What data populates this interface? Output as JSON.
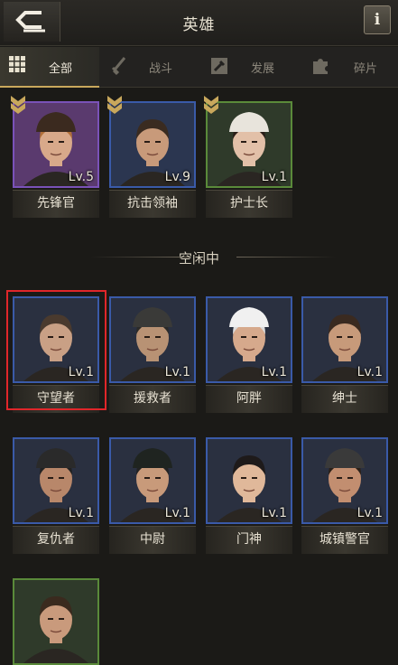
{
  "header": {
    "title": "英雄",
    "info_label": "i"
  },
  "tabs": [
    {
      "label": "全部",
      "icon": "grid-icon"
    },
    {
      "label": "战斗",
      "icon": "sword-icon"
    },
    {
      "label": "发展",
      "icon": "hammer-icon"
    },
    {
      "label": "碎片",
      "icon": "puzzle-icon"
    }
  ],
  "deployed": [
    {
      "name": "先锋官",
      "level": "Lv.5",
      "frame": "purple",
      "bg": "#5a3a6e",
      "hair": "#b0703a",
      "skin": "#d8a98a",
      "hat": "#3b2a1f"
    },
    {
      "name": "抗击领袖",
      "level": "Lv.9",
      "frame": "blue",
      "bg": "#2b3650",
      "hair": "#3a2b20",
      "skin": "#c89a7a",
      "hat": ""
    },
    {
      "name": "护士长",
      "level": "Lv.1",
      "frame": "green",
      "bg": "#2f3a2a",
      "hair": "#2a1e18",
      "skin": "#e2c0a8",
      "hat": "#e8e4dc"
    }
  ],
  "section_label": "空闲中",
  "idle": [
    {
      "name": "守望者",
      "level": "Lv.1",
      "frame": "blue",
      "bg": "#2a3040",
      "hair": "#4a3a2e",
      "skin": "#c9a085",
      "hat": ""
    },
    {
      "name": "援救者",
      "level": "Lv.1",
      "frame": "blue",
      "bg": "#2a3040",
      "hair": "#2b2a28",
      "skin": "#b89274",
      "hat": "#3a3a38"
    },
    {
      "name": "阿胖",
      "level": "Lv.1",
      "frame": "blue",
      "bg": "#2a3040",
      "hair": "#ddd",
      "skin": "#d6a98c",
      "hat": "#f0f0f0"
    },
    {
      "name": "绅士",
      "level": "Lv.1",
      "frame": "blue",
      "bg": "#2a3040",
      "hair": "#3a2a20",
      "skin": "#c79a7a",
      "hat": ""
    },
    {
      "name": "复仇者",
      "level": "Lv.1",
      "frame": "blue",
      "bg": "#2a3040",
      "hair": "#222",
      "skin": "#b8876a",
      "hat": "#2a2a2a"
    },
    {
      "name": "中尉",
      "level": "Lv.1",
      "frame": "blue",
      "bg": "#2a3040",
      "hair": "#222",
      "skin": "#c89a7a",
      "hat": "#1f2420"
    },
    {
      "name": "门神",
      "level": "Lv.1",
      "frame": "blue",
      "bg": "#2a3040",
      "hair": "#1e1a1a",
      "skin": "#e0b89a",
      "hat": ""
    },
    {
      "name": "城镇警官",
      "level": "Lv.1",
      "frame": "blue",
      "bg": "#2a3040",
      "hair": "#2a2018",
      "skin": "#c28e70",
      "hat": "#3a3a3a"
    },
    {
      "name": "",
      "level": "",
      "frame": "green",
      "bg": "#2f3a2a",
      "hair": "#3a2a1e",
      "skin": "#c99a7c",
      "hat": ""
    }
  ],
  "colors": {
    "accent": "#c9a85c",
    "selected": "#e0262a"
  }
}
